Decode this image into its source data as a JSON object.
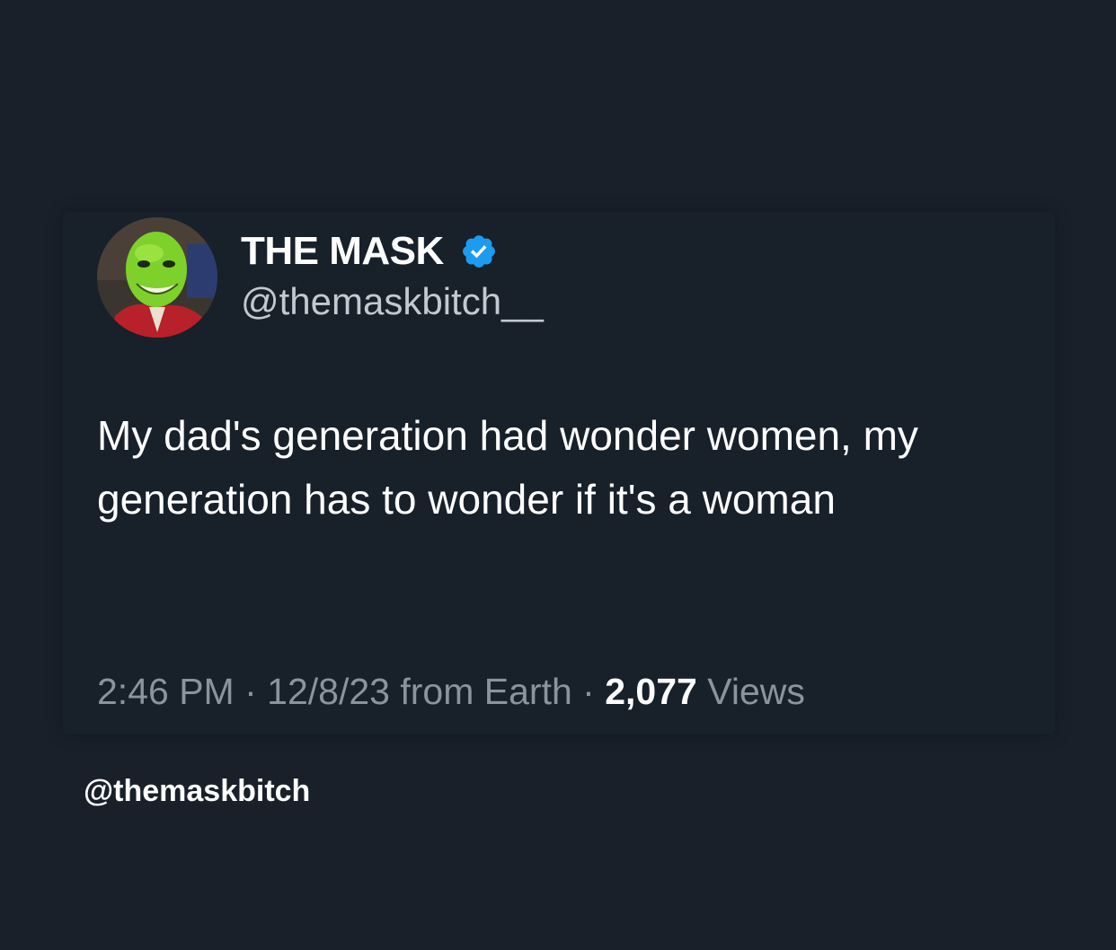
{
  "author": {
    "display_name": "THE MASK",
    "handle": "@themaskbitch__",
    "verified": true,
    "verified_icon": "verified-badge-icon",
    "avatar": "green-mask-face-avatar"
  },
  "tweet": {
    "text": "My dad's generation had wonder women, my generation has to wonder if it's a woman"
  },
  "meta": {
    "time": "2:46 PM",
    "separator": "·",
    "date": "12/8/23",
    "source": "from Earth",
    "views_count": "2,077",
    "views_label": "Views"
  },
  "watermark": "@themaskbitch",
  "colors": {
    "background": "#19202a",
    "text_primary": "#ffffff",
    "text_secondary": "#8b939d",
    "verified_blue": "#1d9bf0"
  }
}
